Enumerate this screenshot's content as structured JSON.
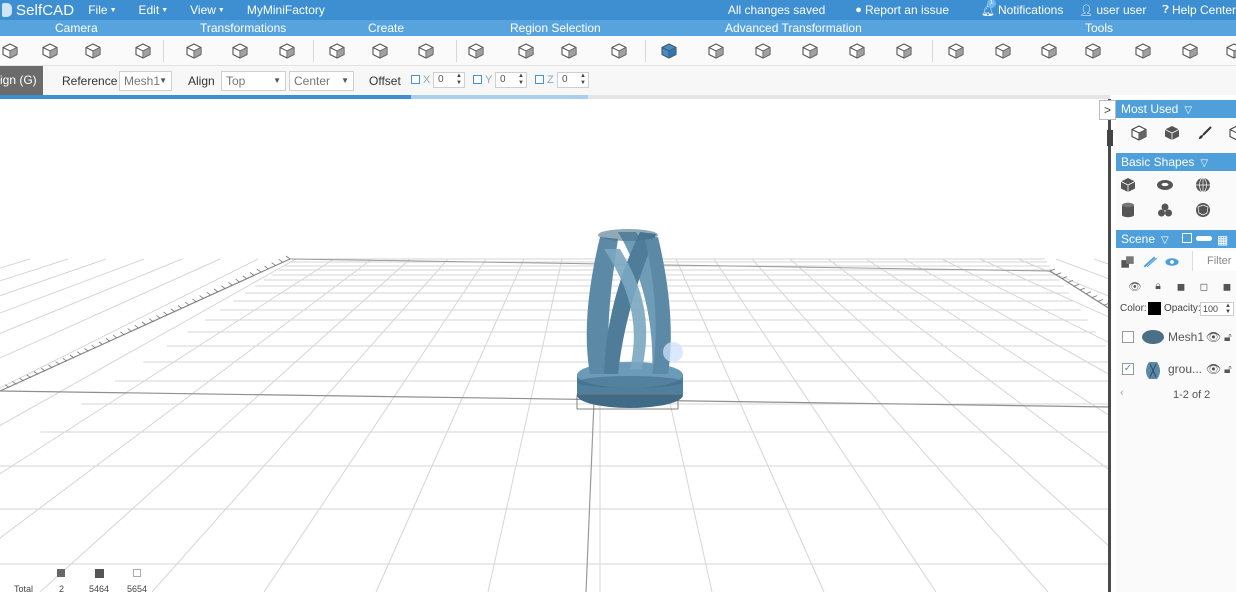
{
  "menubar": {
    "app_name": "SelfCAD",
    "menus": [
      {
        "label": "File"
      },
      {
        "label": "Edit"
      },
      {
        "label": "View"
      }
    ],
    "link": "MyMiniFactory",
    "status": "All changes saved",
    "report": "Report an issue",
    "notifications": "Notifications",
    "notification_count": "1",
    "user": "user user",
    "help": "Help Center"
  },
  "categories": [
    {
      "label": "Camera"
    },
    {
      "label": "Transformations"
    },
    {
      "label": "Create"
    },
    {
      "label": "Region Selection"
    },
    {
      "label": "Advanced Transformation"
    },
    {
      "label": "Tools"
    }
  ],
  "toolbar_icons": [
    "front-view-icon",
    "rotate-view-icon",
    "screenshot-icon",
    "clipboard-icon",
    "move-icon",
    "scale-icon",
    "rotate-icon",
    "extrude-icon",
    "loft-icon",
    "solidify-icon",
    "select-all-icon",
    "region-select-icon",
    "vertex-select-icon",
    "face-select-icon",
    "smooth-icon",
    "subdivide-icon",
    "bend-icon",
    "taper-icon",
    "twist-icon",
    "shear-icon",
    "cut-icon",
    "boolean-icon",
    "wireframe-icon",
    "sphere-tool-icon",
    "mirror-icon",
    "array-icon",
    "more-icon"
  ],
  "options": {
    "mode": "ign (G)",
    "reference_label": "Reference",
    "reference_value": "Mesh1",
    "align_label": "Align",
    "align_value": "Top",
    "align2_value": "Center",
    "offset_label": "Offset",
    "x_label": "X",
    "x_value": "0",
    "y_label": "Y",
    "y_value": "0",
    "z_label": "Z",
    "z_value": "0",
    "progress": 0.37
  },
  "stats": {
    "total_label": "Total",
    "objects": "2",
    "faces": "5464",
    "vertices": "5654"
  },
  "right_panel": {
    "collapse_glyph": ">",
    "most_used": "Most Used",
    "basic_shapes": "Basic Shapes",
    "scene": "Scene",
    "filter_placeholder": "Filter",
    "color_label": "Color:",
    "color_value": "#000000",
    "opacity_label": "Opacity:",
    "opacity_value": "100",
    "items": [
      {
        "name": "Mesh1",
        "checked": false
      },
      {
        "name": "grou...",
        "checked": true
      }
    ],
    "pager": "1-2 of 2"
  },
  "colors": {
    "menubar": "#3d8fd1",
    "category_bar": "#57a3dd",
    "accent": "#4f9fdb",
    "model": "#5b89a6"
  }
}
